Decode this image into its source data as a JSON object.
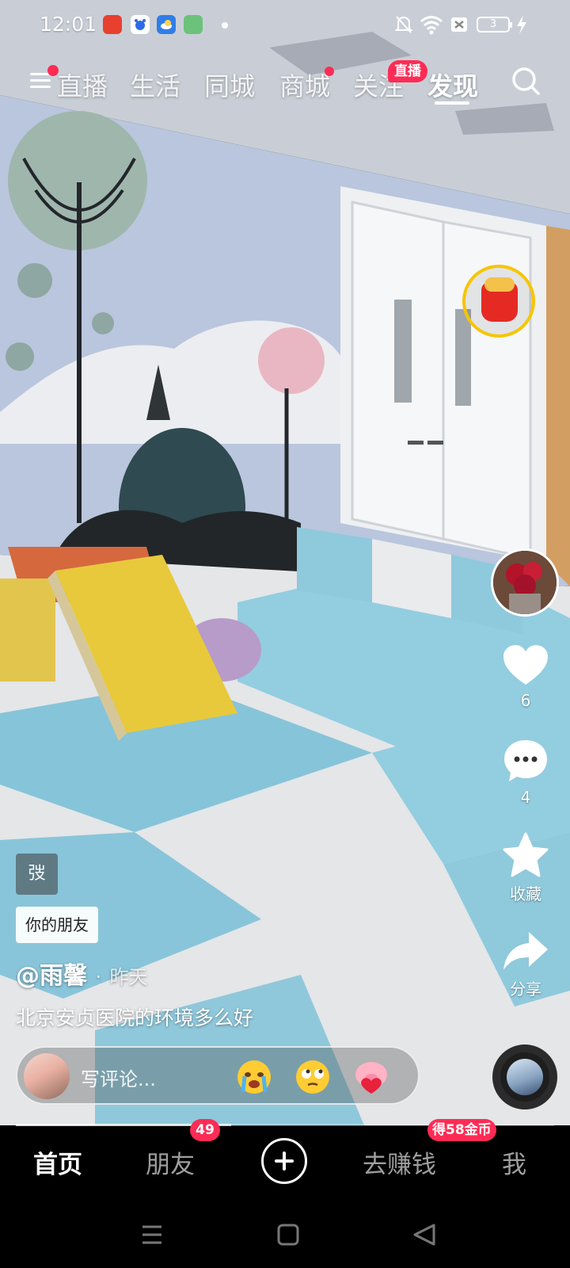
{
  "status_bar": {
    "time": "12:01",
    "battery": "3",
    "icons": [
      "app-icon-red",
      "baidu-icon",
      "weather-icon",
      "game-icon",
      "notification-dot",
      "mute-bell-icon",
      "wifi-icon",
      "sim-x-icon",
      "battery-icon",
      "charging-icon"
    ]
  },
  "top_nav": {
    "tabs": [
      {
        "label": "直播",
        "active": false
      },
      {
        "label": "生活",
        "active": false
      },
      {
        "label": "同城",
        "active": false
      },
      {
        "label": "商城",
        "active": false
      },
      {
        "label": "关注",
        "active": false
      },
      {
        "label": "发现",
        "active": true
      }
    ],
    "live_badge": "直播",
    "icons": [
      "menu-icon",
      "search-icon"
    ]
  },
  "video": {
    "tag": "弢",
    "friend_chip": "你的朋友",
    "author": "@雨馨",
    "separator": "·",
    "posted": "昨天",
    "caption": "北京安贞医院的环境多么好",
    "progress": 0.4
  },
  "actions": {
    "like_count": "6",
    "comment_count": "4",
    "favorite_label": "收藏",
    "share_label": "分享"
  },
  "comment_bar": {
    "placeholder": "写评论...",
    "emojis": [
      "crying-emoji",
      "eye-roll-emoji",
      "pig-heart-emoji"
    ]
  },
  "tab_bar": {
    "home": "首页",
    "friends": "朋友",
    "friends_badge": "49",
    "earn": "去赚钱",
    "earn_badge": "得58金币",
    "me": "我"
  },
  "colors": {
    "accent": "#fe2c55",
    "coin_ring": "#f7c500",
    "wall": "#b8c6dc",
    "mat_blue": "#8fc9dc",
    "mat_white": "#e6e8ea"
  }
}
